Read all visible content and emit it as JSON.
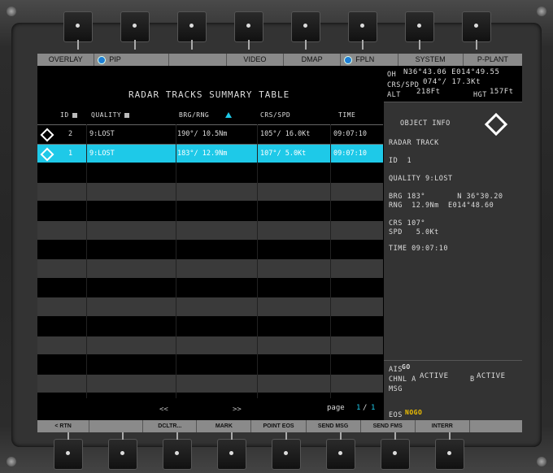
{
  "top_bar": {
    "overlay": "OVERLAY",
    "pip": "PIP",
    "video": "VIDEO",
    "dmap": "DMAP",
    "fpln": "FPLN",
    "system": "SYSTEM",
    "pplant": "P-PLANT"
  },
  "table": {
    "title": "RADAR TRACKS SUMMARY TABLE",
    "headers": {
      "id": "ID",
      "quality": "QUALITY",
      "brg_rng": "BRG/RNG",
      "crs_spd": "CRS/SPD",
      "time": "TIME"
    },
    "rows": [
      {
        "id": "2",
        "quality": "9:LOST",
        "brg_rng": "190°/ 10.5Nm",
        "crs_spd": "105°/ 16.0Kt",
        "time": "09:07:10"
      },
      {
        "id": "1",
        "quality": "9:LOST",
        "brg_rng": "183°/ 12.9Nm",
        "crs_spd": "107°/  5.0Kt",
        "time": "09:07:10"
      }
    ],
    "pager": {
      "prev": "<<",
      "next": ">>",
      "label": "page",
      "page": "1",
      "sep": "/",
      "total": "1"
    }
  },
  "own_ship": {
    "oh_label": "OH",
    "oh_value": "N36°43.06 E014°49.55",
    "crsspd_label": "CRS/SPD",
    "crsspd_value": "074°/ 17.3Kt",
    "alt_label": "ALT",
    "alt_value": "218Ft",
    "hgt_label": "HGT",
    "hgt_value": "157Ft"
  },
  "object_info": {
    "title": "OBJECT INFO",
    "type": "RADAR TRACK",
    "id": "ID  1",
    "quality": "QUALITY 9:LOST",
    "brg": "BRG 183°       N 36°30.20",
    "rng": "RNG  12.9Nm  E014°48.60",
    "crs": "CRS 107°",
    "spd": "SPD   5.0Kt",
    "time": "TIME 09:07:10"
  },
  "status": {
    "ais_label": "AIS",
    "ais_value": "GO",
    "chnl_label": "CHNL A",
    "chnl_a_value": "ACTIVE",
    "chnl_b_label": "B",
    "chnl_b_value": "ACTIVE",
    "msg_label": "MSG",
    "eos_label": "EOS",
    "eos_value": "NOGO"
  },
  "bottom_bar": {
    "rtn": "< RTN",
    "dcltr": "DCLTR...",
    "mark": "MARK",
    "point_eos": "POINT EOS",
    "send_msg": "SEND MSG",
    "send_fms": "SEND FMS",
    "interr": "INTERR"
  },
  "colors": {
    "accent": "#1ec9e8",
    "warning": "#f0c000",
    "bar": "#8a8a8a"
  }
}
